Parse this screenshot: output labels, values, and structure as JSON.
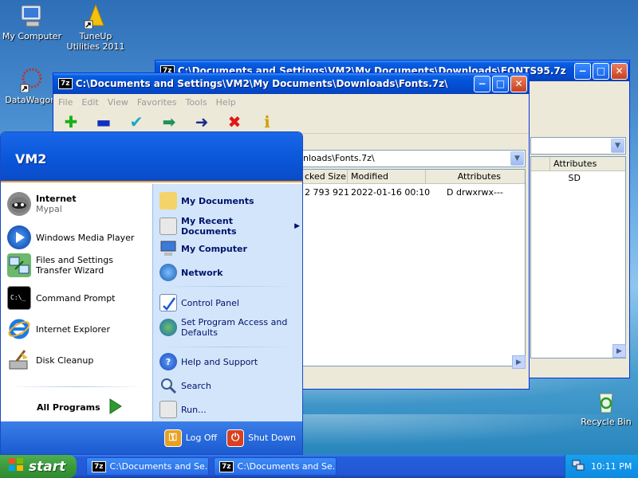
{
  "desktop": {
    "icons": [
      {
        "label": "My Computer",
        "icon": "my-computer-icon"
      },
      {
        "label": "TuneUp Utilities 2011",
        "icon": "tuneup-icon"
      },
      {
        "label": "DataWagon.",
        "icon": "datawagon-icon"
      },
      {
        "label": "Recycle Bin",
        "icon": "recycle-bin-icon"
      }
    ]
  },
  "back_window": {
    "title": "C:\\Documents and Settings\\VM2\\My Documents\\Downloads\\FONTS95.7z",
    "columns": [
      "Attributes"
    ],
    "row": [
      "SD"
    ]
  },
  "front_window": {
    "title": "C:\\Documents and Settings\\VM2\\My Documents\\Downloads\\Fonts.7z\\",
    "menu": [
      "File",
      "Edit",
      "View",
      "Favorites",
      "Tools",
      "Help"
    ],
    "path": "nloads\\Fonts.7z\\",
    "columns": [
      "cked Size",
      "Modified",
      "Attributes"
    ],
    "row": [
      "2 793 921",
      "2022-01-16 00:10",
      "D drwxrwx---"
    ]
  },
  "start_menu": {
    "user": "VM2",
    "left": [
      {
        "label": "Internet",
        "sub": "Mypal"
      },
      {
        "label": "Windows Media Player"
      },
      {
        "label": "Files and Settings Transfer Wizard"
      },
      {
        "label": "Command Prompt"
      },
      {
        "label": "Internet Explorer"
      },
      {
        "label": "Disk Cleanup"
      }
    ],
    "all_programs": "All Programs",
    "right": [
      {
        "label": "My Documents"
      },
      {
        "label": "My Recent Documents"
      },
      {
        "label": "My Computer"
      },
      {
        "label": "Network"
      },
      {
        "label": "Control Panel"
      },
      {
        "label": "Set Program Access and Defaults"
      },
      {
        "label": "Help and Support"
      },
      {
        "label": "Search"
      },
      {
        "label": "Run..."
      }
    ],
    "log_off": "Log Off",
    "shut_down": "Shut Down"
  },
  "taskbar": {
    "start_label": "start",
    "tasks": [
      {
        "label": "C:\\Documents and Se..."
      },
      {
        "label": "C:\\Documents and Se..."
      }
    ],
    "clock": "10:11 PM"
  },
  "colors": {
    "xp_blue": "#0a5fe0",
    "start_green": "#3c9a3c",
    "start_menu_right": "#d3e5fa"
  }
}
